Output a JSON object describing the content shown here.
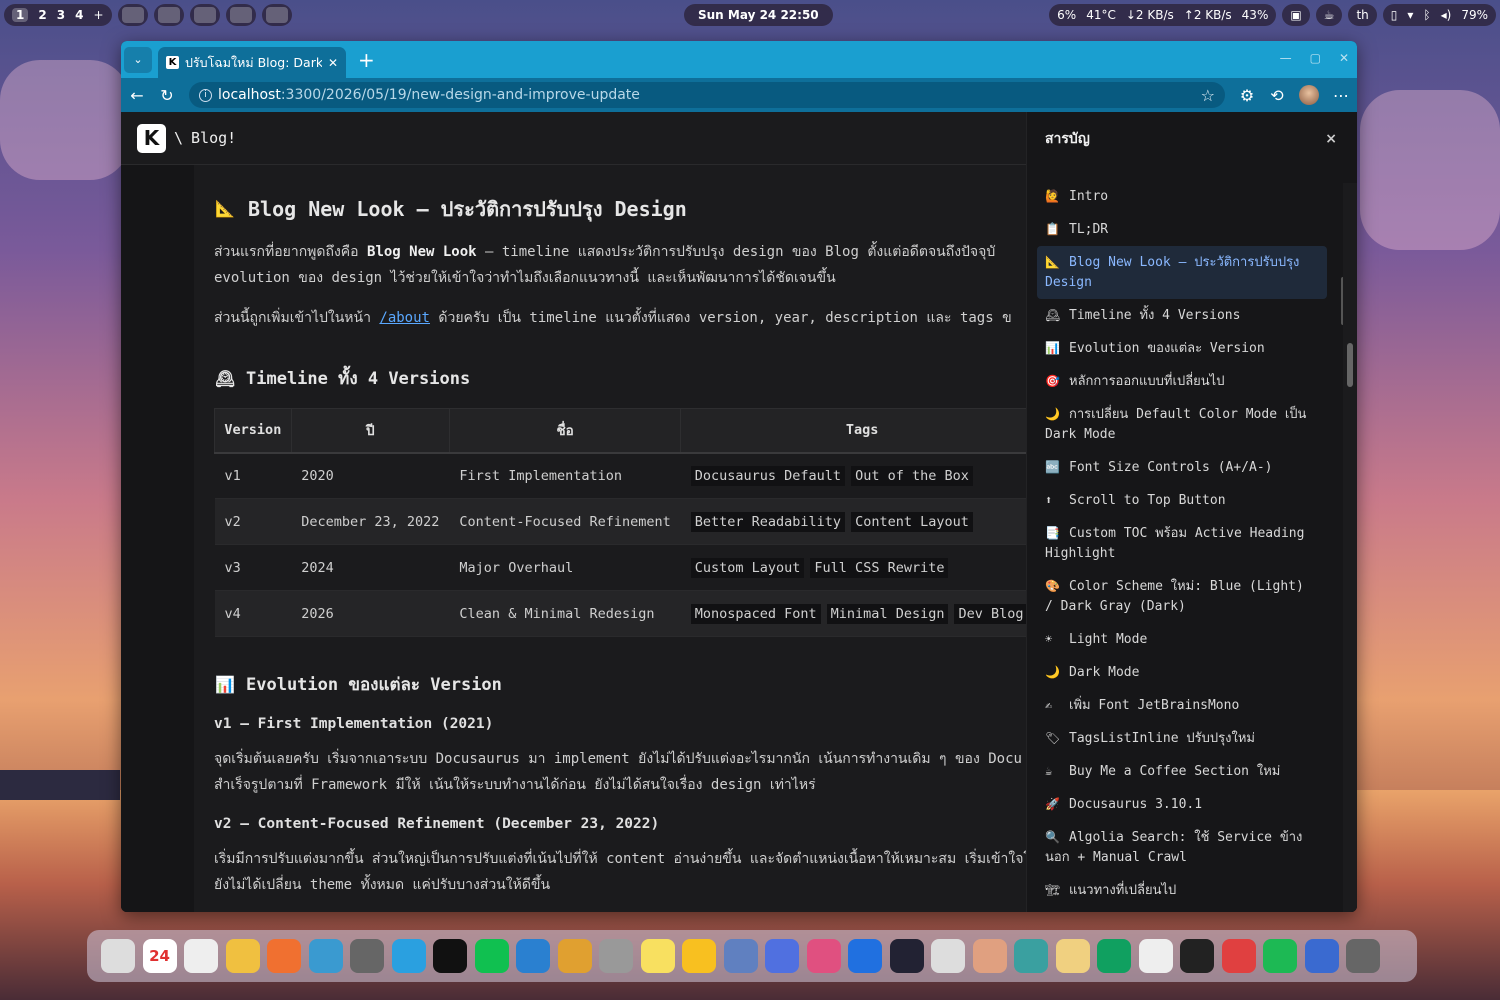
{
  "topbar": {
    "workspaces": [
      "1",
      "2",
      "3",
      "4"
    ],
    "workspace_extra": "+",
    "datetime": "Sun May 24  22:50",
    "status": {
      "cpu": "6%",
      "temp": "41°C",
      "down": "↓2 KB/s",
      "up": "↑2 KB/s",
      "battery1": "43%",
      "lang": "th",
      "battery2": "79%"
    }
  },
  "browser": {
    "tab_title": "ปรับโฉมใหม่ Blog: Dark Mo",
    "tab_favicon": "K",
    "url_host": "localhost",
    "url_path": ":3300/2026/05/19/new-design-and-improve-update",
    "accent": "#1a9fd0"
  },
  "site": {
    "logo": "K",
    "breadcrumb_sep": "\\",
    "breadcrumb": "Blog!"
  },
  "article": {
    "h2": "Blog New Look — ประวัติการปรับปรุง Design",
    "p1_a": "ส่วนแรกที่อยากพูดถึงคือ ",
    "p1_b": "Blog New Look",
    "p1_c": " — timeline แสดงประวัติการปรับปรุง design ของ Blog ตั้งแต่อดีตจนถึงปัจจุบั",
    "p1_line2": "evolution ของ design ไว้ช่วยให้เข้าใจว่าทำไมถึงเลือกแนวทางนี้ และเห็นพัฒนาการได้ชัดเจนขึ้น",
    "p2_a": "ส่วนนี้ถูกเพิ่มเข้าไปในหน้า ",
    "p2_link": "/about",
    "p2_b": " ด้วยครับ เป็น timeline แนวตั้งที่แสดง version, year, description และ tags ข",
    "h3_timeline": "Timeline ทั้ง 4 Versions",
    "table": {
      "headers": [
        "Version",
        "ปี",
        "ชื่อ",
        "Tags"
      ],
      "rows": [
        {
          "version": "v1",
          "year": "2020",
          "name": "First Implementation",
          "tags": [
            "Docusaurus Default",
            "Out of the Box"
          ]
        },
        {
          "version": "v2",
          "year": "December 23, 2022",
          "name": "Content-Focused Refinement",
          "tags": [
            "Better Readability",
            "Content Layout"
          ]
        },
        {
          "version": "v3",
          "year": "2024",
          "name": "Major Overhaul",
          "tags": [
            "Custom Layout",
            "Full CSS Rewrite"
          ]
        },
        {
          "version": "v4",
          "year": "2026",
          "name": "Clean & Minimal Redesign",
          "tags": [
            "Monospaced Font",
            "Minimal Design",
            "Dev Blog"
          ]
        }
      ]
    },
    "h3_evolution": "Evolution ของแต่ละ Version",
    "h4_v1": "v1 — First Implementation (2021)",
    "p_v1_line1": "จุดเริ่มต้นเลยครับ เริ่มจากเอาระบบ Docusaurus มา implement ยังไม่ได้ปรับแต่งอะไรมากนัก เน้นการทำงานเดิม ๆ ของ Docu",
    "p_v1_line2": "สำเร็จรูปตามที่ Framework มีให้ เน้นให้ระบบทำงานได้ก่อน ยังไม่ได้สนใจเรื่อง design เท่าไหร่",
    "h4_v2": "v2 — Content-Focused Refinement (December 23, 2022)",
    "p_v2_line1": "เริ่มมีการปรับแต่งมากขึ้น ส่วนใหญ่เป็นการปรับแต่งที่เน้นไปที่ให้ content อ่านง่ายขึ้น และจัดตำแหน่งเนื้อหาให้เหมาะสม เริ่มเข้าใจโครง",
    "p_v2_line2": "ยังไม่ได้เปลี่ยน theme ทั้งหมด แค่ปรับบางส่วนให้ดีขึ้น"
  },
  "toc": {
    "title": "สารบัญ",
    "close": "×",
    "items": [
      {
        "icon": "🙋",
        "label": "Intro"
      },
      {
        "icon": "📋",
        "label": "TL;DR"
      },
      {
        "icon": "📐",
        "label": "Blog New Look — ประวัติการปรับปรุง Design",
        "active": true
      },
      {
        "icon": "🕰",
        "label": "Timeline ทั้ง 4 Versions"
      },
      {
        "icon": "📊",
        "label": "Evolution ของแต่ละ Version"
      },
      {
        "icon": "🎯",
        "label": "หลักการออกแบบที่เปลี่ยนไป"
      },
      {
        "icon": "🌙",
        "label": "การเปลี่ยน Default Color Mode เป็น Dark Mode"
      },
      {
        "icon": "🔤",
        "label": "Font Size Controls (A+/A-)"
      },
      {
        "icon": "⬆",
        "label": "Scroll to Top Button"
      },
      {
        "icon": "📑",
        "label": "Custom TOC พร้อม Active Heading Highlight"
      },
      {
        "icon": "🎨",
        "label": "Color Scheme ใหม่: Blue (Light) / Dark Gray (Dark)"
      },
      {
        "icon": "☀",
        "label": "Light Mode"
      },
      {
        "icon": "🌙",
        "label": "Dark Mode"
      },
      {
        "icon": "✍",
        "label": "เพิ่ม Font JetBrainsMono"
      },
      {
        "icon": "🏷",
        "label": "TagsListInline ปรับปรุงใหม่"
      },
      {
        "icon": "☕",
        "label": "Buy Me a Coffee Section ใหม่"
      },
      {
        "icon": "🚀",
        "label": "Docusaurus 3.10.1"
      },
      {
        "icon": "🔍",
        "label": "Algolia Search: ใช้ Service ข้างนอก + Manual Crawl"
      },
      {
        "icon": "🏗",
        "label": "แนวทางที่เปลี่ยนไป"
      }
    ]
  },
  "dock": {
    "calendar_day": "24",
    "icons": [
      "apps-grid-icon",
      "calendar-icon",
      "clock-icon",
      "files-icon",
      "text-editor-icon",
      "fish-icon",
      "calculator-icon",
      "telegram-icon",
      "webstorm-icon",
      "line-icon",
      "edge-icon",
      "dog-icon",
      "settings-icon",
      "notes-icon",
      "lightbulb-icon",
      "toggle-icon",
      "chat-icon",
      "paint-icon",
      "extension-icon",
      "speedometer-icon",
      "game-icon",
      "draw-icon",
      "box-icon",
      "ring-icon",
      "book-icon",
      "document-icon",
      "key-icon",
      "apps-store-icon",
      "spotify-icon",
      "download-folder-icon",
      "trash-icon"
    ]
  }
}
